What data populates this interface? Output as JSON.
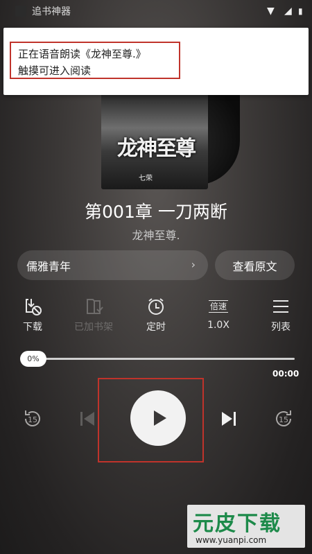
{
  "status_bar": {
    "app_name": "追书神器"
  },
  "notification": {
    "line1": "正在语音朗读《龙神至尊.》",
    "line2": "触摸可进入阅读"
  },
  "cover": {
    "title": "龙神至尊",
    "author": "七荣"
  },
  "chapter": {
    "title": "第001章 一刀两断",
    "book": "龙神至尊."
  },
  "voice": {
    "label": "儒雅青年",
    "chevron": "›"
  },
  "original_button": "查看原文",
  "tools": {
    "download": "下载",
    "bookshelf": "已加书架",
    "timer": "定时",
    "speed_icon": "倍速",
    "speed": "1.0X",
    "list": "列表"
  },
  "progress": {
    "percent_label": "0%",
    "value": 0,
    "time": "00:00"
  },
  "controls": {
    "rewind_seconds": "15",
    "forward_seconds": "15"
  },
  "watermark": {
    "logo": "元皮下载",
    "url": "www.yuanpi.com"
  },
  "colors": {
    "highlight": "#c0332b",
    "watermark_green": "#1d8a4a"
  }
}
